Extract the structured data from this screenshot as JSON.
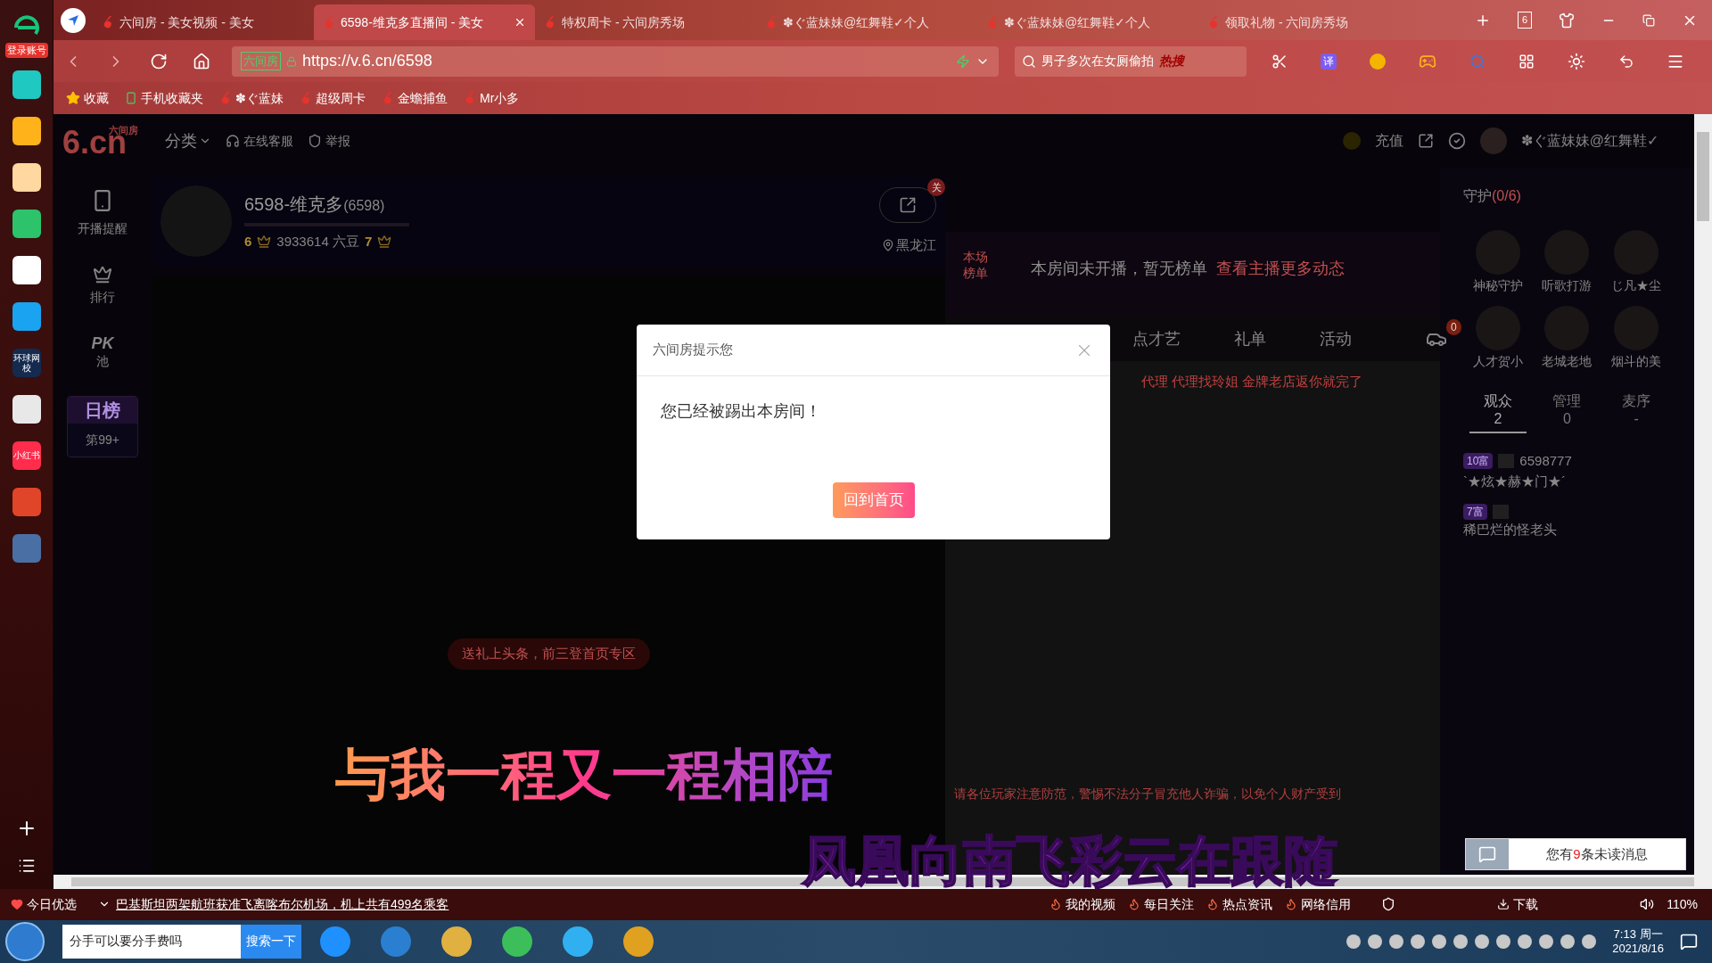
{
  "sidebar": {
    "login": "登录账号",
    "apps": [
      {
        "color": "#1fc9c2"
      },
      {
        "color": "#ffb21a"
      },
      {
        "color": "#ffd7a0"
      },
      {
        "color": "#2cc36b"
      },
      {
        "color": "#ffffff"
      },
      {
        "color": "#1aa3f0"
      },
      {
        "color": "#142a4f",
        "label": "环球网校"
      },
      {
        "color": "#e8e8e8"
      },
      {
        "color": "#ff2d4b",
        "label": "小红书"
      },
      {
        "color": "#e0452a"
      },
      {
        "color": "#4a6fa5"
      }
    ]
  },
  "tabs": [
    {
      "title": "六间房 - 美女视频 - 美女",
      "selected": false
    },
    {
      "title": "6598-维克多直播间 - 美女",
      "selected": true
    },
    {
      "title": "特权周卡 - 六间房秀场",
      "selected": false
    },
    {
      "title": "✽ぐ蓝妹妹@红舞鞋✓个人",
      "selected": false
    },
    {
      "title": "✽ぐ蓝妹妹@红舞鞋✓个人",
      "selected": false
    },
    {
      "title": "领取礼物 - 六间房秀场",
      "selected": false
    }
  ],
  "tab_count": "6",
  "address": {
    "site_badge": "六间房",
    "url": "https://v.6.cn/6598"
  },
  "search": {
    "value": "男子多次在女厕偷拍",
    "hot": "热搜"
  },
  "translate": "译",
  "bookmarks": [
    "收藏",
    "手机收藏夹",
    "✽ぐ蓝妹",
    "超级周卡",
    "金蟾捕鱼",
    "Mr小多"
  ],
  "page": {
    "logo": "6.cn",
    "logo_sub": "六间房",
    "nav": [
      "分类",
      "在线客服",
      "举报"
    ],
    "recharge": "充值",
    "user": "✽ぐ蓝妹妹@红舞鞋✓",
    "left_nav": [
      "开播提醒",
      "排行",
      "PK",
      "池"
    ],
    "daily_rank": "日榜",
    "daily_place": "第99+",
    "anchor": {
      "name": "6598-维克多",
      "room": "(6598)",
      "level": "6",
      "beans": "3933614 六豆",
      "level2": "7",
      "location": "黑龙江",
      "follow_badge": "关"
    },
    "board": {
      "label": "本场榜单",
      "notice": "本房间未开播，暂无榜单",
      "link": "查看主播更多动态"
    },
    "room_tabs": [
      "点才艺",
      "礼单",
      "活动"
    ],
    "car_count": "0",
    "chat_line": "代理 代理找玲姐 金牌老店返你就完了",
    "gift_banner": "送礼上头条，前三登首页专区",
    "warning": "请各位玩家注意防范，警惕不法分子冒充他人诈骗，以免个人财产受到",
    "guard": {
      "title": "守护",
      "count": "(0/6)",
      "members": [
        "神秘守护",
        "听歌打游",
        "じ凡★尘",
        "人才贺小",
        "老城老地",
        "烟斗的美"
      ]
    },
    "audience_tabs": [
      {
        "label": "观众",
        "count": "2",
        "selected": true
      },
      {
        "label": "管理",
        "count": "0",
        "selected": false
      },
      {
        "label": "麦序",
        "count": "-",
        "selected": false
      }
    ],
    "audience": [
      {
        "rank": "10富",
        "id": "6598777",
        "name": "`★炫★赫★门★´"
      },
      {
        "rank": "7富",
        "name": "稀巴烂的怪老头"
      }
    ]
  },
  "dialog": {
    "title": "六间房提示您",
    "message": "您已经被踢出本房间！",
    "button": "回到首页"
  },
  "lyrics": [
    "与我一程又一程相陪",
    "凤凰向南飞彩云在跟随"
  ],
  "unread": {
    "prefix": "您有",
    "count": "9",
    "suffix": "条未读消息"
  },
  "status_bar": {
    "today": "今日优选",
    "news": "巴基斯坦两架航班获准飞离喀布尔机场，机上共有499名乘客",
    "items": [
      "我的视频",
      "每日关注",
      "热点资讯",
      "网络信用"
    ],
    "download": "下载",
    "zoom": "110%"
  },
  "taskbar": {
    "search": "分手可以要分手费吗",
    "search_button": "搜索一下",
    "time": "7:13 周一",
    "date": "2021/8/16"
  }
}
